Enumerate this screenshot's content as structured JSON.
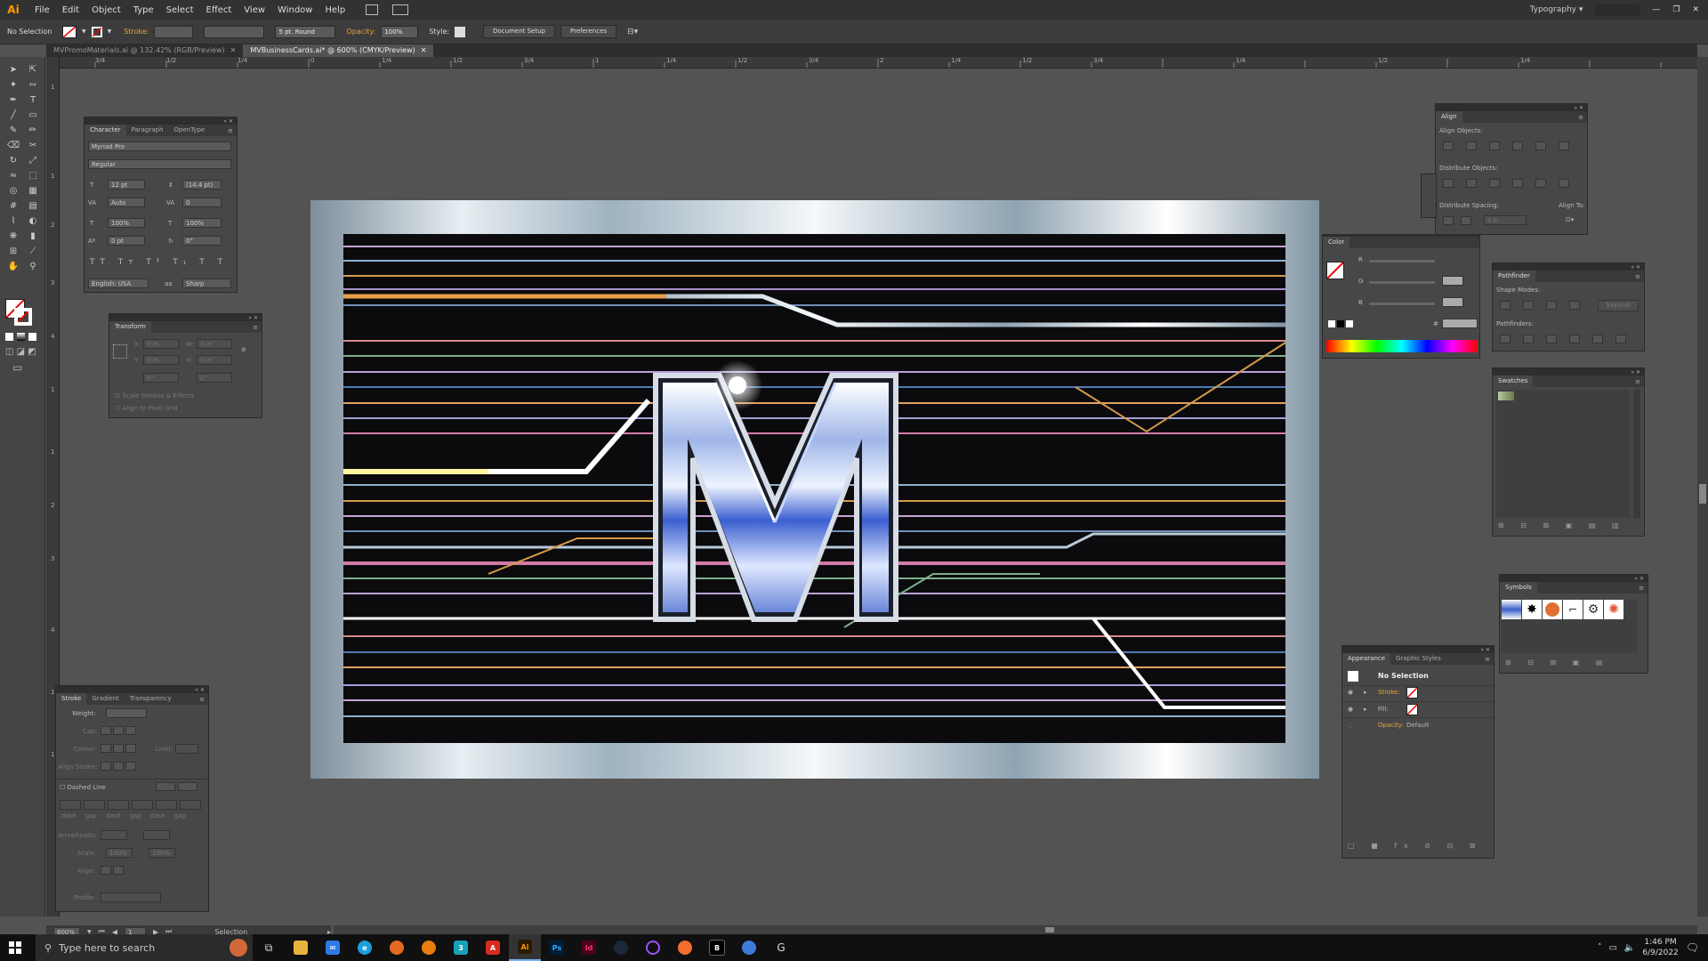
{
  "app": {
    "logo": "Ai",
    "workspace": "Typography"
  },
  "menu": [
    "File",
    "Edit",
    "Object",
    "Type",
    "Select",
    "Effect",
    "View",
    "Window",
    "Help"
  ],
  "control": {
    "selection": "No Selection",
    "stroke_label": "Stroke:",
    "brush": "5 pt. Round",
    "opacity_label": "Opacity:",
    "opacity": "100%",
    "style_label": "Style:",
    "document_setup": "Document Setup",
    "preferences": "Preferences"
  },
  "tabs": [
    {
      "label": "MVPromoMaterials.ai @ 132.42% (RGB/Preview)",
      "active": false
    },
    {
      "label": "MVBusinessCards.ai* @ 600% (CMYK/Preview)",
      "active": true
    }
  ],
  "ruler": {
    "top": [
      "3/4",
      "1/2",
      "1/4",
      "0",
      "1/4",
      "1/2",
      "3/4",
      "1",
      "1/4",
      "1/2",
      "3/4",
      "2",
      "1/4",
      "1/2",
      "3/4",
      "1/4",
      "1/2",
      "1/4"
    ],
    "left": [
      "1",
      "1",
      "2",
      "3",
      "4",
      "1",
      "1",
      "2",
      "3",
      "4",
      "1",
      "1",
      "2",
      "3",
      "4",
      "5",
      "6"
    ]
  },
  "character": {
    "tabs": [
      "Character",
      "Paragraph",
      "OpenType"
    ],
    "font": "Myriad Pro",
    "style": "Regular",
    "size": "12 pt",
    "leading": "(14.4 pt)",
    "kerning": "Auto",
    "tracking": "0",
    "vscale": "100%",
    "hscale": "100%",
    "baseline": "0 pt",
    "rotation": "0°",
    "language": "English: USA",
    "aa_label": "aa",
    "antialias": "Sharp"
  },
  "transform": {
    "title": "Transform",
    "x": "0 in",
    "y": "0 in",
    "w": "0 in",
    "h": "0 in",
    "angle": "0°",
    "shear": "0°",
    "scale_strokes": "Scale Strokes & Effects",
    "align_pixel": "Align to Pixel Grid"
  },
  "stroke_panel": {
    "tabs": [
      "Stroke",
      "Gradient",
      "Transparency"
    ],
    "weight_label": "Weight:",
    "cap_label": "Cap:",
    "corner_label": "Corner:",
    "limit_label": "Limit:",
    "align_label": "Align Stroke:",
    "dashed_line": "Dashed Line",
    "dash_labels": [
      "dash",
      "gap",
      "dash",
      "gap",
      "dash",
      "gap"
    ],
    "arrowheads_label": "Arrowheads:",
    "scale_label": "Scale:",
    "scale_a": "100%",
    "scale_b": "100%",
    "align2_label": "Align:",
    "profile_label": "Profile:"
  },
  "align_panel": {
    "title": "Align",
    "align_objects": "Align Objects:",
    "distribute_objects": "Distribute Objects:",
    "distribute_spacing": "Distribute Spacing:",
    "align_to": "Align To:",
    "spacing": "0 in"
  },
  "color_panel": {
    "title": "Color",
    "channels": [
      "R",
      "G",
      "B"
    ],
    "hex_label": "#"
  },
  "pathfinder": {
    "title": "Pathfinder",
    "shape_modes": "Shape Modes:",
    "pathfinders": "Pathfinders:",
    "expand": "Expand"
  },
  "swatches": {
    "title": "Swatches"
  },
  "symbols": {
    "title": "Symbols"
  },
  "appearance": {
    "tabs": [
      "Appearance",
      "Graphic Styles"
    ],
    "selection": "No Selection",
    "stroke_label": "Stroke:",
    "fill_label": "Fill:",
    "opacity_label": "Opacity:",
    "opacity_value": "Default"
  },
  "status": {
    "zoom": "600%",
    "page": "1",
    "tool": "Selection"
  },
  "taskbar": {
    "search_placeholder": "Type here to search",
    "time": "1:46 PM",
    "date": "6/9/2022"
  },
  "colors": {
    "accent": "#ff9a00",
    "ui_bg": "#535353",
    "panel": "#474747",
    "taskbar": "#101010"
  }
}
